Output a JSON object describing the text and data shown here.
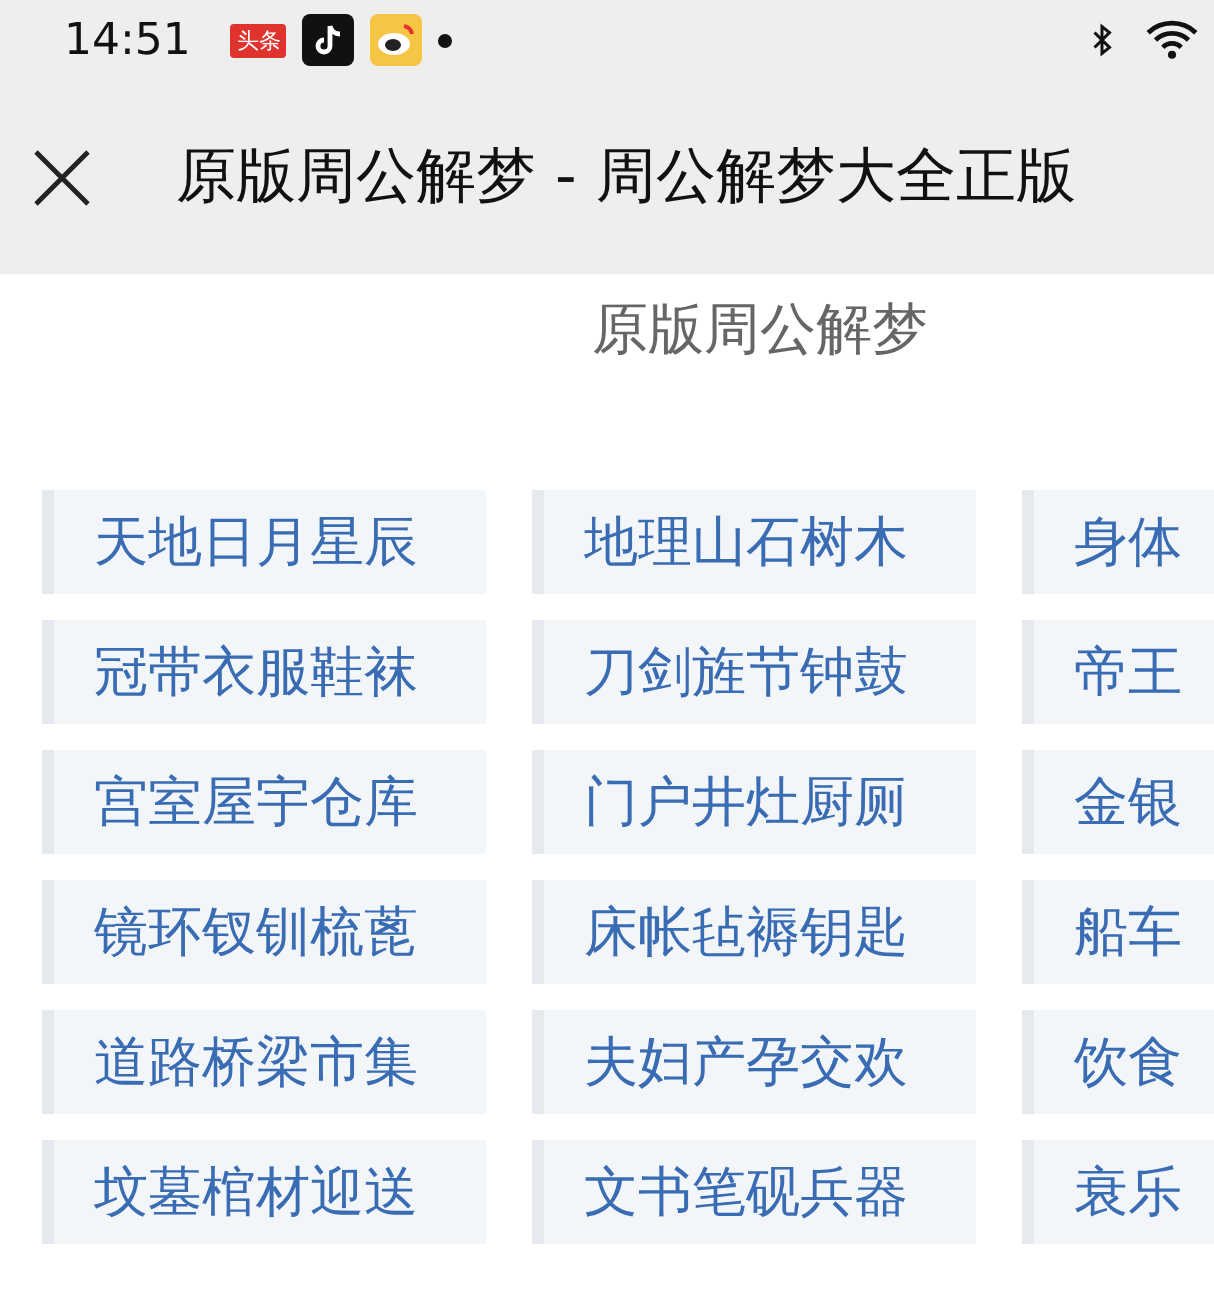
{
  "status_bar": {
    "time": "14:51",
    "notification_icons": [
      {
        "kind": "toutiao",
        "label": "头条"
      },
      {
        "kind": "tiktok"
      },
      {
        "kind": "weibo"
      }
    ],
    "more_dot": true
  },
  "toolbar": {
    "title": "原版周公解梦 - 周公解梦大全正版"
  },
  "heading": "原版周公解梦",
  "categories": [
    [
      "天地日月星辰",
      "地理山石树木",
      "身体"
    ],
    [
      "冠带衣服鞋袜",
      "刀剑旌节钟鼓",
      "帝王"
    ],
    [
      "宫室屋宇仓库",
      "门户井灶厨厕",
      "金银"
    ],
    [
      "镜环钗钏梳蓖",
      "床帐毡褥钥匙",
      "船车"
    ],
    [
      "道路桥梁市集",
      "夫妇产孕交欢",
      "饮食"
    ],
    [
      "坟墓棺材迎送",
      "文书笔砚兵器",
      "衰乐"
    ]
  ]
}
